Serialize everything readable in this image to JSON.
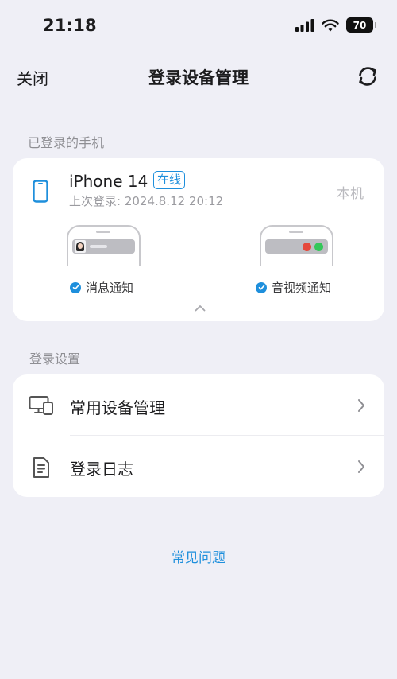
{
  "status_bar": {
    "time": "21:18",
    "battery": "70"
  },
  "nav": {
    "close_label": "关闭",
    "title": "登录设备管理"
  },
  "logged_in": {
    "section_label": "已登录的手机",
    "device": {
      "name": "iPhone 14",
      "status_badge": "在线",
      "last_login": "上次登录: 2024.8.12 20:12",
      "this_device": "本机"
    },
    "options": {
      "message_notify": "消息通知",
      "av_notify": "音视频通知"
    }
  },
  "login_settings": {
    "section_label": "登录设置",
    "items": [
      {
        "label": "常用设备管理",
        "icon": "devices-icon"
      },
      {
        "label": "登录日志",
        "icon": "document-icon"
      }
    ]
  },
  "faq_label": "常见问题",
  "colors": {
    "accent": "#1e8fdc",
    "background": "#efeff6",
    "card": "#ffffff"
  }
}
